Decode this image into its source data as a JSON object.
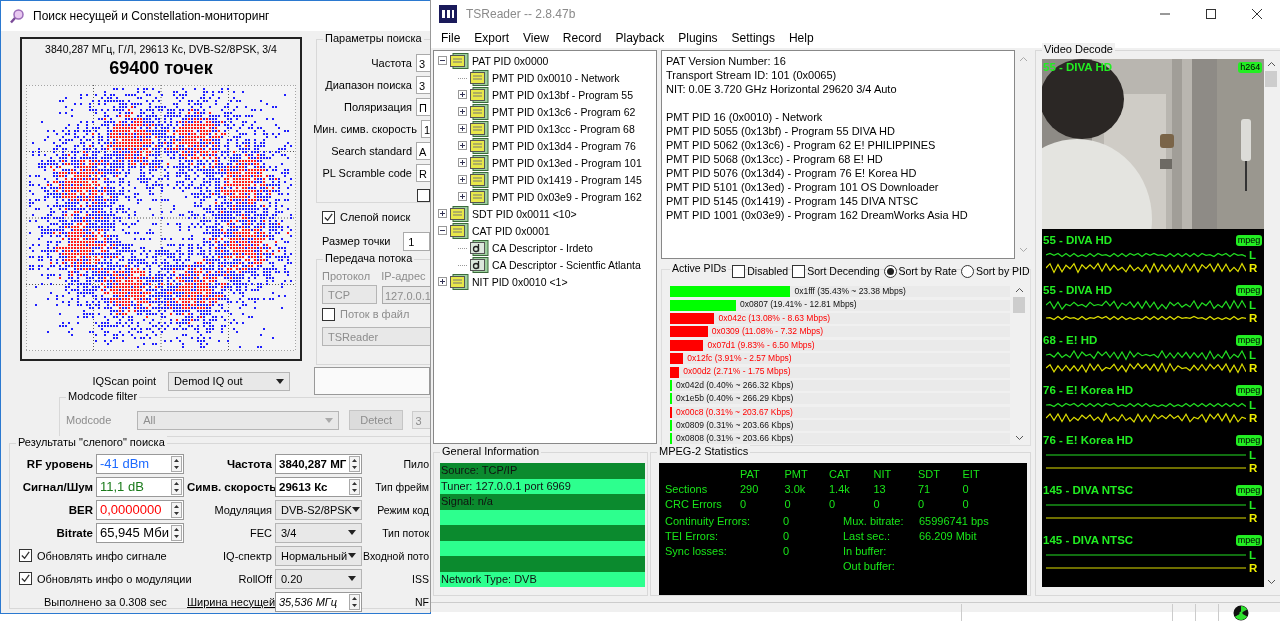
{
  "left_window": {
    "title": "Поиск несущей и Constellation-мониторинг",
    "constellation": {
      "caption": "3840,287 МГц, Г/Л, 29613 Кс, DVB-S2/8PSK, 3/4",
      "points": "69400 точек"
    },
    "search_params": {
      "legend": "Параметры поиска",
      "fields": [
        {
          "label": "Частота",
          "value": "3"
        },
        {
          "label": "Диапазон поиска",
          "value": "3"
        },
        {
          "label": "Поляризация",
          "value": "П"
        },
        {
          "label": "Мин. симв. скорость",
          "value": "1"
        },
        {
          "label": "Search standard",
          "value": "A"
        },
        {
          "label": "PL Scramble code",
          "value": "R"
        }
      ],
      "extra_checked": false
    },
    "blind_search": {
      "label": "Слепой поиск",
      "checked": true
    },
    "dot_size": {
      "label": "Размер точки",
      "value": "1"
    },
    "stream": {
      "legend": "Передача потока",
      "protocol_label": "Протокол",
      "address_label": "IP-адрес",
      "protocol": "TCP",
      "address": "127.0.0.1",
      "to_file": {
        "label": "Поток в файл",
        "checked": false
      },
      "target": "TSReader",
      "disabled": true
    },
    "iqscan": {
      "label": "IQScan point",
      "value": "Demod IQ out"
    },
    "modcode": {
      "legend": "Modcode filter",
      "label": "Modcode",
      "value": "All",
      "detect": "Detect",
      "timeout": "3",
      "disabled": true
    },
    "results": {
      "legend": "Результаты \"слепого\" поиска",
      "signal": [
        {
          "label": "RF уровень",
          "value": "-41 dBm",
          "color": "#1e6bff"
        },
        {
          "label": "Сигнал/Шум",
          "value": "11,1 dB",
          "color": "#1a7a1a"
        },
        {
          "label": "BER",
          "value": "0,0000000",
          "color": "#ff0000"
        },
        {
          "label": "Bitrate",
          "value": "65,945 Мби",
          "color": "#000000"
        }
      ],
      "options": [
        {
          "label": "Обновлять инфо сигнале",
          "checked": true
        },
        {
          "label": "Обновлять инфо о модуляции",
          "checked": true
        }
      ],
      "elapsed": "Выполнено за 0.308 sec",
      "carrier": [
        {
          "kind": "spin",
          "label": "Частота",
          "value": "3840,287 МГ"
        },
        {
          "kind": "spin",
          "label": "Симв. скорость",
          "value": "29613 Кс"
        },
        {
          "kind": "select",
          "label": "Модуляция",
          "value": "DVB-S2/8PSK"
        },
        {
          "kind": "select",
          "label": "FEC",
          "value": "3/4"
        },
        {
          "kind": "select",
          "label": "IQ-спектр",
          "value": "Нормальный"
        },
        {
          "kind": "select",
          "label": "RollOff",
          "value": "0.20"
        },
        {
          "kind": "link-spin",
          "label": "Ширина несущей",
          "value": "35,536 МГц"
        }
      ],
      "more_labels": [
        "Пило",
        "Тип фрейм",
        "Режим код",
        "Тип поток",
        "Входной пото",
        "ISS",
        "NF"
      ]
    }
  },
  "tsreader": {
    "title": "TSReader -- 2.8.47b",
    "menu": [
      "File",
      "Export",
      "View",
      "Record",
      "Playback",
      "Plugins",
      "Settings",
      "Help"
    ],
    "tree": [
      {
        "kind": "table",
        "label": "PAT PID 0x0000",
        "expanded": true,
        "children": [
          {
            "kind": "table",
            "label": "PMT PID 0x0010 - Network"
          },
          {
            "kind": "table",
            "label": "PMT PID 0x13bf - Program 55",
            "expanded": false
          },
          {
            "kind": "table",
            "label": "PMT PID 0x13c6 - Program 62",
            "expanded": false
          },
          {
            "kind": "table",
            "label": "PMT PID 0x13cc - Program 68",
            "expanded": false
          },
          {
            "kind": "table",
            "label": "PMT PID 0x13d4 - Program 76",
            "expanded": false
          },
          {
            "kind": "table",
            "label": "PMT PID 0x13ed - Program 101",
            "expanded": false
          },
          {
            "kind": "table",
            "label": "PMT PID 0x1419 - Program 145",
            "expanded": false
          },
          {
            "kind": "table",
            "label": "PMT PID 0x03e9 - Program 162",
            "expanded": false
          }
        ]
      },
      {
        "kind": "table",
        "label": "SDT PID 0x0011 <10>",
        "expanded": false
      },
      {
        "kind": "table",
        "label": "CAT PID 0x0001",
        "expanded": true,
        "children": [
          {
            "kind": "descriptor",
            "label": "CA Descriptor - Irdeto"
          },
          {
            "kind": "descriptor",
            "label": "CA Descriptor - Scientfic Atlanta"
          }
        ]
      },
      {
        "kind": "table",
        "label": "NIT PID 0x0010 <1>",
        "expanded": false
      }
    ],
    "info_blocks": [
      [
        "PAT Version Number: 16",
        "Transport Stream ID: 101 (0x0065)",
        "NIT: 0.0E 3.720 GHz Horizontal 29620 3/4 Auto"
      ],
      [
        "PMT PID 16 (0x0010) - Network",
        "PMT PID 5055 (0x13bf) - Program 55 DIVA HD",
        "PMT PID 5062 (0x13c6) - Program 62 E! PHILIPPINES",
        "PMT PID 5068 (0x13cc) - Program 68 E! HD",
        "PMT PID 5076 (0x13d4) - Program 76 E! Korea HD",
        "PMT PID 5101 (0x13ed) - Program 101 OS Downloader",
        "PMT PID 5145 (0x1419) - Program 145 DIVA NTSC",
        "PMT PID 1001 (0x03e9) - Program 162 DreamWorks Asia HD"
      ]
    ],
    "active_pids": {
      "legend": "Active PIDs",
      "options": [
        {
          "kind": "checkbox",
          "label": "Disabled",
          "checked": false
        },
        {
          "kind": "checkbox",
          "label": "Sort Decending",
          "checked": false
        },
        {
          "kind": "radio",
          "label": "Sort by Rate",
          "selected": true
        },
        {
          "kind": "radio",
          "label": "Sort by PID",
          "selected": false
        }
      ],
      "rows": [
        {
          "label": "0x1fff (35.43% ~ 23.38 Mbps)",
          "level": 0.3543,
          "color": "#00ff00",
          "flagged": false
        },
        {
          "label": "0x0807 (19.41% - 12.81 Mbps)",
          "level": 0.1941,
          "color": "#00ff00",
          "flagged": false
        },
        {
          "label": "0x042c (13.08% - 8.63 Mbps)",
          "level": 0.1308,
          "color": "#ff0000",
          "flagged": true
        },
        {
          "label": "0x0309 (11.08% - 7.32 Mbps)",
          "level": 0.1108,
          "color": "#ff0000",
          "flagged": true
        },
        {
          "label": "0x07d1 (9.83% - 6.50 Mbps)",
          "level": 0.0983,
          "color": "#ff0000",
          "flagged": true
        },
        {
          "label": "0x12fc (3.91% - 2.57 Mbps)",
          "level": 0.0391,
          "color": "#ff0000",
          "flagged": true
        },
        {
          "label": "0x00d2 (2.71% - 1.75 Mbps)",
          "level": 0.0271,
          "color": "#ff0000",
          "flagged": true
        },
        {
          "label": "0x042d (0.40% ~ 266.32 Kbps)",
          "level": 0.004,
          "color": "#00ff00",
          "flagged": false
        },
        {
          "label": "0x1e5b (0.40% ~ 266.29 Kbps)",
          "level": 0.004,
          "color": "#00ff00",
          "flagged": false
        },
        {
          "label": "0x00c8 (0.31% ~ 203.67 Kbps)",
          "level": 0.0031,
          "color": "#ff0000",
          "flagged": true
        },
        {
          "label": "0x0809 (0.31% ~ 203.66 Kbps)",
          "level": 0.0031,
          "color": "#00ff00",
          "flagged": false
        },
        {
          "label": "0x0808 (0.31% ~ 203.66 Kbps)",
          "level": 0.0031,
          "color": "#00ff00",
          "flagged": false
        }
      ]
    },
    "general_info": {
      "legend": "General Information",
      "lines": [
        "Source: TCP/IP",
        "Tuner: 127.0.0.1 port 6969",
        "Signal: n/a"
      ],
      "footer": "Network Type: DVB"
    },
    "mpeg_stats": {
      "legend": "MPEG-2 Statistics",
      "columns": [
        "PAT",
        "PMT",
        "CAT",
        "NIT",
        "SDT",
        "EIT"
      ],
      "rows": [
        {
          "label": "Sections",
          "values": [
            "290",
            "3.0k",
            "1.4k",
            "13",
            "71",
            "0"
          ]
        },
        {
          "label": "CRC Errors",
          "values": [
            "0",
            "0",
            "0",
            "0",
            "0",
            "0"
          ]
        }
      ],
      "errors": [
        {
          "label": "Continuity Errors:",
          "value": "0"
        },
        {
          "label": "TEI Errors:",
          "value": "0"
        },
        {
          "label": "Sync losses:",
          "value": "0"
        }
      ],
      "bitrate": [
        {
          "label": "Mux. bitrate:",
          "value": "65996741 bps"
        },
        {
          "label": "Last sec.:",
          "value": "66.209 Mbit"
        },
        {
          "label": "In buffer:"
        },
        {
          "label": "Out buffer:"
        }
      ]
    },
    "video_decode": {
      "legend": "Video Decode",
      "items": [
        {
          "kind": "video",
          "title": "55 - DIVA HD",
          "codec": "h264"
        },
        {
          "kind": "audio",
          "title": "55 - DIVA HD",
          "codec": "mpeg",
          "channels": [
            "L",
            "R"
          ],
          "silent": false
        },
        {
          "kind": "audio",
          "title": "55 - DIVA HD",
          "codec": "mpeg",
          "channels": [
            "L",
            "R"
          ],
          "silent": false
        },
        {
          "kind": "audio",
          "title": "68 - E! HD",
          "codec": "mpeg",
          "channels": [
            "L",
            "R"
          ],
          "silent": false
        },
        {
          "kind": "audio",
          "title": "76 - E! Korea HD",
          "codec": "mpeg",
          "channels": [
            "L",
            "R"
          ],
          "silent": false
        },
        {
          "kind": "audio",
          "title": "76 - E! Korea HD",
          "codec": "mpeg",
          "channels": [
            "L",
            "R"
          ],
          "silent": true
        },
        {
          "kind": "audio",
          "title": "145 - DIVA NTSC",
          "codec": "mpeg",
          "channels": [
            "L",
            "R"
          ],
          "silent": true
        },
        {
          "kind": "audio",
          "title": "145 - DIVA NTSC",
          "codec": "mpeg",
          "channels": [
            "L",
            "R"
          ],
          "silent": true
        }
      ]
    }
  }
}
